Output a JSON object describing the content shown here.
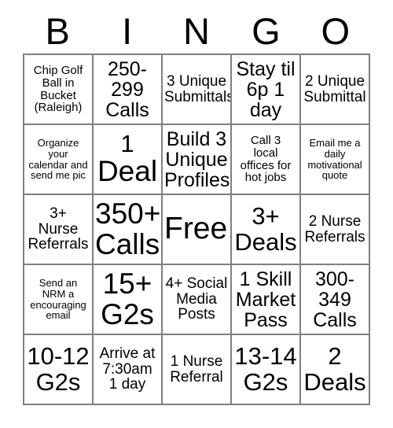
{
  "header": {
    "letters": [
      "B",
      "I",
      "N",
      "G",
      "O"
    ]
  },
  "colors": {
    "grid_line": "#808080",
    "text": "#000000",
    "background": "#ffffff"
  },
  "grid": {
    "columns": 5,
    "rows": 5,
    "cells": [
      [
        {
          "name": "cell-b1",
          "lines": [
            "Chip Golf",
            "Ball in",
            "Bucket",
            "(Raleigh)"
          ],
          "size": "t-s",
          "free": false
        },
        {
          "name": "cell-i1",
          "lines": [
            "250-",
            "299",
            "Calls"
          ],
          "size": "t-l",
          "free": false
        },
        {
          "name": "cell-n1",
          "lines": [
            "3 Unique",
            "Submittals"
          ],
          "size": "t-m",
          "free": false
        },
        {
          "name": "cell-g1",
          "lines": [
            "Stay til",
            "6p 1",
            "day"
          ],
          "size": "t-l",
          "free": false
        },
        {
          "name": "cell-o1",
          "lines": [
            "2 Unique",
            "Submittal"
          ],
          "size": "t-m",
          "free": false
        }
      ],
      [
        {
          "name": "cell-b2",
          "lines": [
            "Organize",
            "your",
            "calendar and",
            "send me pic"
          ],
          "size": "t-xs",
          "free": false
        },
        {
          "name": "cell-i2",
          "lines": [
            "1",
            "Deal"
          ],
          "size": "t-xxl",
          "free": false,
          "first_line_size": "t-xl"
        },
        {
          "name": "cell-n2",
          "lines": [
            "Build 3",
            "Unique",
            "Profiles"
          ],
          "size": "t-l",
          "free": false
        },
        {
          "name": "cell-g2",
          "lines": [
            "Call 3",
            "local",
            "offices for",
            "hot jobs"
          ],
          "size": "t-s",
          "free": false
        },
        {
          "name": "cell-o2",
          "lines": [
            "Email me a",
            "daily",
            "motivational",
            "quote"
          ],
          "size": "t-xs",
          "free": false
        }
      ],
      [
        {
          "name": "cell-b3",
          "lines": [
            "3+",
            "Nurse",
            "Referrals"
          ],
          "size": "t-m",
          "free": false
        },
        {
          "name": "cell-i3",
          "lines": [
            "350+",
            "Calls"
          ],
          "size": "t-xxl",
          "free": false
        },
        {
          "name": "cell-n3",
          "lines": [
            "Free!"
          ],
          "size": "t-free",
          "free": true
        },
        {
          "name": "cell-g3",
          "lines": [
            "3+",
            "Deals"
          ],
          "size": "t-xl",
          "free": false
        },
        {
          "name": "cell-o3",
          "lines": [
            "2 Nurse",
            "Referrals"
          ],
          "size": "t-m",
          "free": false
        }
      ],
      [
        {
          "name": "cell-b4",
          "lines": [
            "Send an",
            "NRM a",
            "encouraging",
            "email"
          ],
          "size": "t-xs",
          "free": false
        },
        {
          "name": "cell-i4",
          "lines": [
            "15+",
            "G2s"
          ],
          "size": "t-xxl",
          "free": false
        },
        {
          "name": "cell-n4",
          "lines": [
            "4+ Social",
            "Media",
            "Posts"
          ],
          "size": "t-m",
          "free": false
        },
        {
          "name": "cell-g4",
          "lines": [
            "1 Skill",
            "Market",
            "Pass"
          ],
          "size": "t-l",
          "free": false
        },
        {
          "name": "cell-o4",
          "lines": [
            "300-",
            "349",
            "Calls"
          ],
          "size": "t-l",
          "free": false
        }
      ],
      [
        {
          "name": "cell-b5",
          "lines": [
            "10-12",
            "G2s"
          ],
          "size": "t-xl",
          "free": false
        },
        {
          "name": "cell-i5",
          "lines": [
            "Arrive at",
            "7:30am",
            "1 day"
          ],
          "size": "t-m",
          "free": false
        },
        {
          "name": "cell-n5",
          "lines": [
            "1 Nurse",
            "Referral"
          ],
          "size": "t-m",
          "free": false
        },
        {
          "name": "cell-g5",
          "lines": [
            "13-14",
            "G2s"
          ],
          "size": "t-xl",
          "free": false
        },
        {
          "name": "cell-o5",
          "lines": [
            "2",
            "Deals"
          ],
          "size": "t-xl",
          "free": false
        }
      ]
    ]
  }
}
